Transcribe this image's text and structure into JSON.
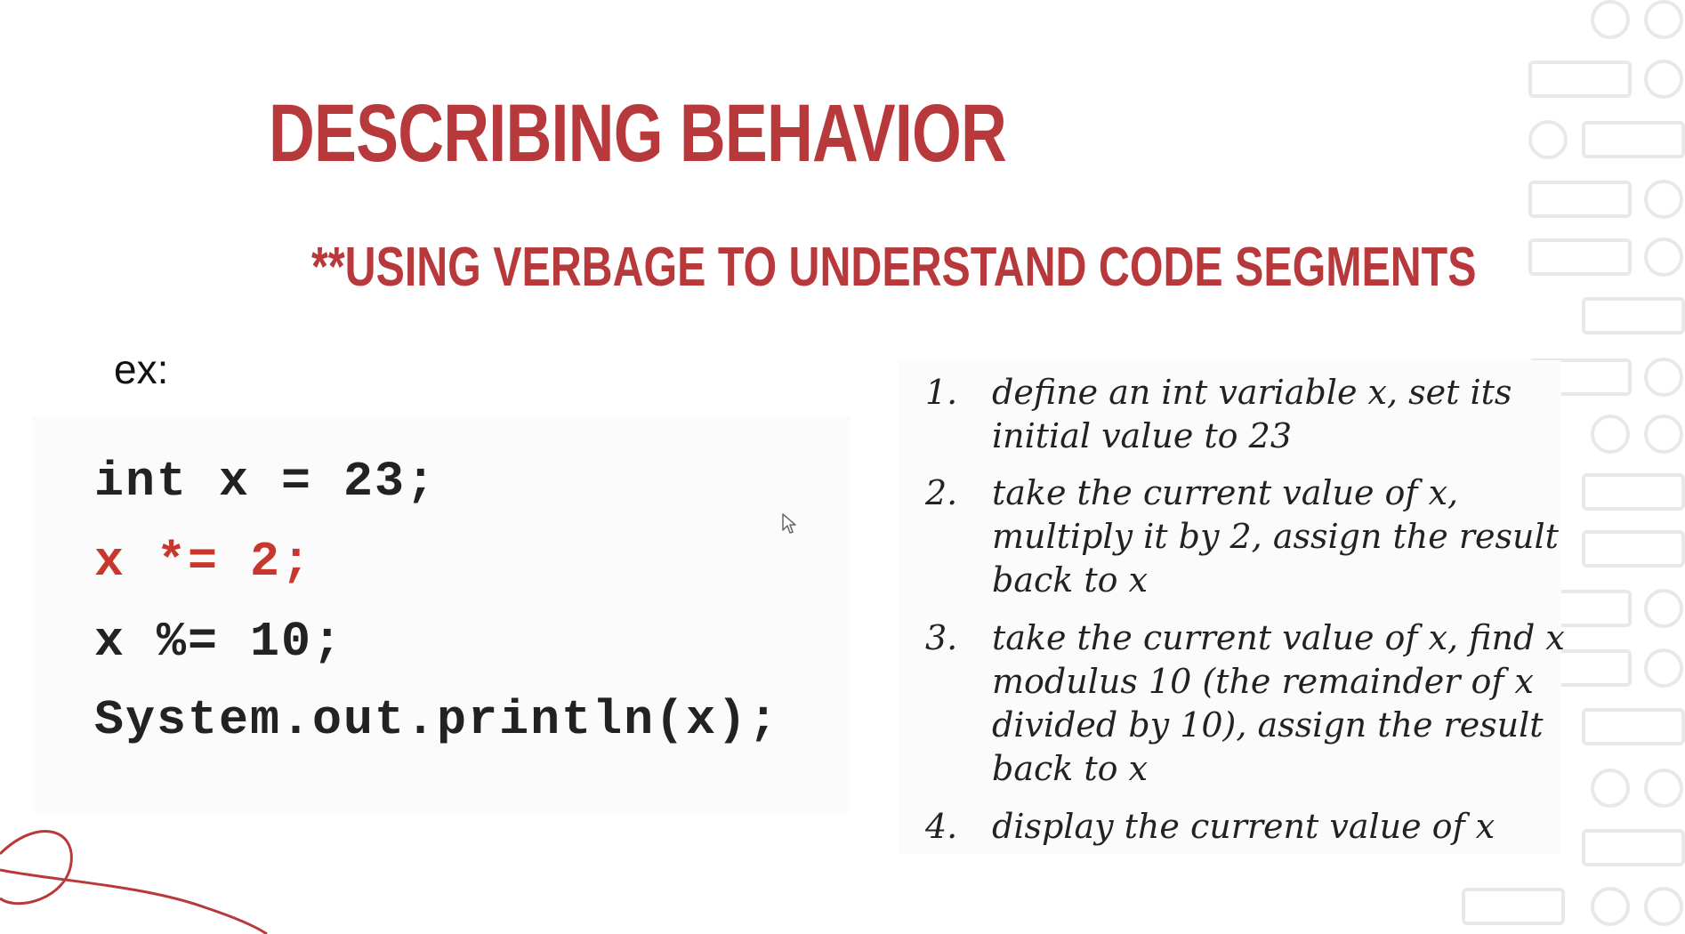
{
  "slide": {
    "title": "Describing Behavior",
    "subtitle": "**Using verbage to understand code segments",
    "example_label": "ex:"
  },
  "code": {
    "lines": [
      "int x = 23;",
      "x *= 2;",
      "x %= 10;",
      "System.out.println(x);"
    ],
    "highlighted_line": 1
  },
  "notes": [
    {
      "num": "1.",
      "text": "define an int variable x, set its initial value to 23"
    },
    {
      "num": "2.",
      "text": "take the current value of x, multiply it by 2, assign the result back to x"
    },
    {
      "num": "3.",
      "text": "take the current value of x, find x modulus 10 (the remainder of x divided by 10), assign the result back to x"
    },
    {
      "num": "4.",
      "text": "display the current value of x"
    }
  ],
  "colors": {
    "accent": "#b8393b",
    "code_highlight": "#c8372d",
    "text": "#222222",
    "pattern": "#ececec"
  },
  "icons": {
    "cursor": "mouse-pointer-icon",
    "pattern": "circle-rect-pattern",
    "swirl": "swirl-decoration"
  }
}
